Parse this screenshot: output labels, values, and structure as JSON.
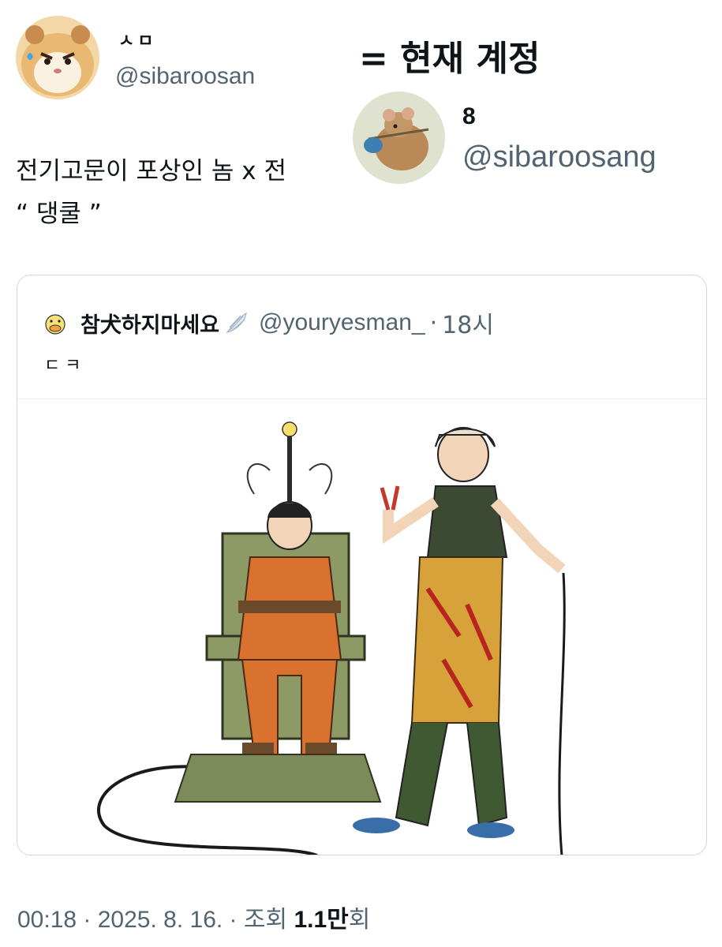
{
  "main_user": {
    "display_name": "ㅅㅁ",
    "handle": "@sibaroosan"
  },
  "overlay": {
    "label": "= 현재 계정"
  },
  "alt_user": {
    "display_name": "8",
    "handle": "@sibaroosang"
  },
  "tweet": {
    "line1": "전기고문이 포상인 놈 x 전",
    "line2": "“ 댕쿨 ”"
  },
  "quote": {
    "display_name": "참犬하지마세요",
    "handle": "@youryesman_",
    "separator": "·",
    "time": "18시",
    "text": "ㄷㅋ"
  },
  "meta": {
    "time": "00:18",
    "sep1": " · ",
    "date": "2025. 8. 16.",
    "sep2": " · ",
    "views_label": "조회 ",
    "views_number": "1.1만",
    "views_suffix": "회"
  }
}
